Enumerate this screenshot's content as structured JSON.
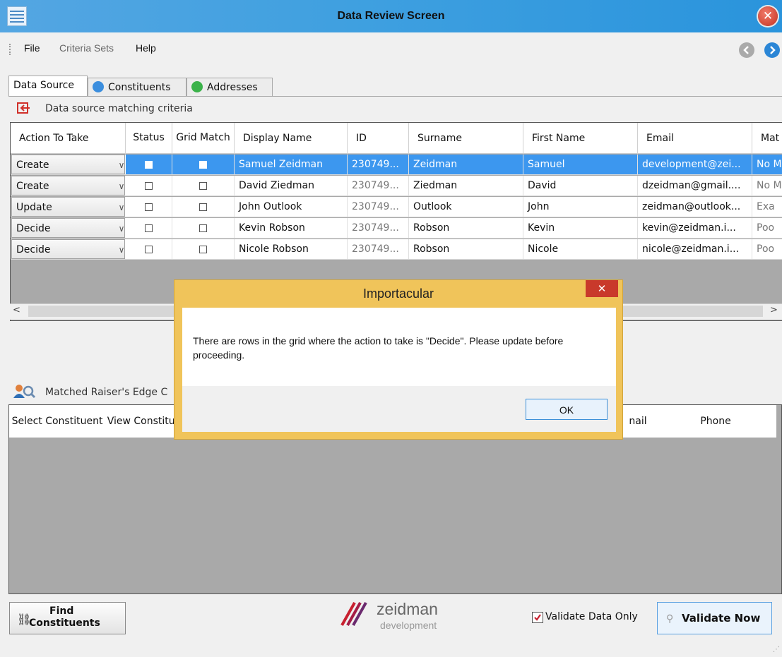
{
  "window": {
    "title": "Data Review Screen"
  },
  "menu": {
    "items": [
      "File",
      "Criteria Sets",
      "Help"
    ]
  },
  "tabs": [
    {
      "label": "Data Source",
      "active": true
    },
    {
      "label": "Constituents",
      "icon": "people-icon"
    },
    {
      "label": "Addresses",
      "icon": "home-icon"
    }
  ],
  "data_source": {
    "section_title": "Data source matching criteria",
    "columns": [
      "Action To Take",
      "Status",
      "Grid Match",
      "Display Name",
      "ID",
      "Surname",
      "First Name",
      "Email",
      "Mat"
    ],
    "rows": [
      {
        "action": "Create",
        "display_name": "Samuel Zeidman",
        "id": "230749...",
        "surname": "Zeidman",
        "first_name": "Samuel",
        "email": "development@zei...",
        "match": "No M",
        "selected": true
      },
      {
        "action": "Create",
        "display_name": "David Ziedman",
        "id": "230749...",
        "surname": "Ziedman",
        "first_name": "David",
        "email": "dzeidman@gmail....",
        "match": "No M"
      },
      {
        "action": "Update",
        "display_name": "John Outlook",
        "id": "230749...",
        "surname": "Outlook",
        "first_name": "John",
        "email": "zeidman@outlook...",
        "match": "Exa"
      },
      {
        "action": "Decide",
        "display_name": "Kevin Robson",
        "id": "230749...",
        "surname": "Robson",
        "first_name": "Kevin",
        "email": "kevin@zeidman.i...",
        "match": "Poo"
      },
      {
        "action": "Decide",
        "display_name": "Nicole Robson",
        "id": "230749...",
        "surname": "Robson",
        "first_name": "Nicole",
        "email": "nicole@zeidman.i...",
        "match": "Poo"
      }
    ]
  },
  "matched": {
    "section_title": "Matched Raiser's Edge C",
    "columns": [
      "Select Constituent",
      "View Constitue",
      "nail",
      "Phone"
    ]
  },
  "dialog": {
    "title": "Importacular",
    "message": "There are rows in the grid where the action to take is \"Decide\". Please update before proceeding.",
    "ok_label": "OK"
  },
  "footer": {
    "find_label_1": "Find",
    "find_label_2": "Constituents",
    "logo_name": "zeidman",
    "logo_sub": "development",
    "validate_only_label": "Validate Data Only",
    "validate_only_checked": true,
    "validate_now_label": "Validate Now"
  },
  "colors": {
    "title_bar": "#3fa0e0",
    "selection": "#3c97ef",
    "dialog_frame": "#f0c45a",
    "logo_red": "#c8202f"
  }
}
